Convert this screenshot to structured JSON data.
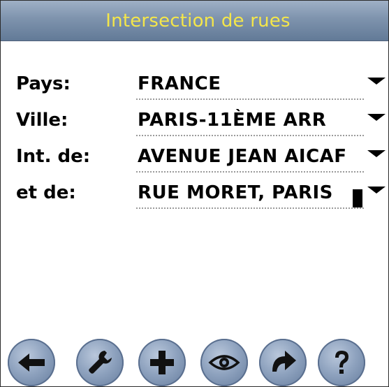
{
  "window": {
    "title": "Intersection de rues"
  },
  "form": {
    "rows": [
      {
        "label": "Pays:",
        "value": "FRANCE"
      },
      {
        "label": "Ville:",
        "value": "PARIS-11ÈME ARR"
      },
      {
        "label": "Int. de:",
        "value": "AVENUE JEAN AICAF"
      },
      {
        "label": "et de:",
        "value": "RUE MORET, PARIS"
      }
    ],
    "dropdown_icon": "triangle-down-icon"
  },
  "toolbar": {
    "buttons": [
      {
        "icon": "arrow-left-icon"
      },
      {
        "icon": "wrench-icon"
      },
      {
        "icon": "plus-icon"
      },
      {
        "icon": "eye-icon"
      },
      {
        "icon": "redo-arrow-icon"
      },
      {
        "icon": "question-mark-icon"
      }
    ]
  },
  "colors": {
    "title_text": "#f4e64a",
    "titlebar_bg": "#7e93ad",
    "button_bg": "#8fa3bf",
    "button_icon": "#111111"
  }
}
